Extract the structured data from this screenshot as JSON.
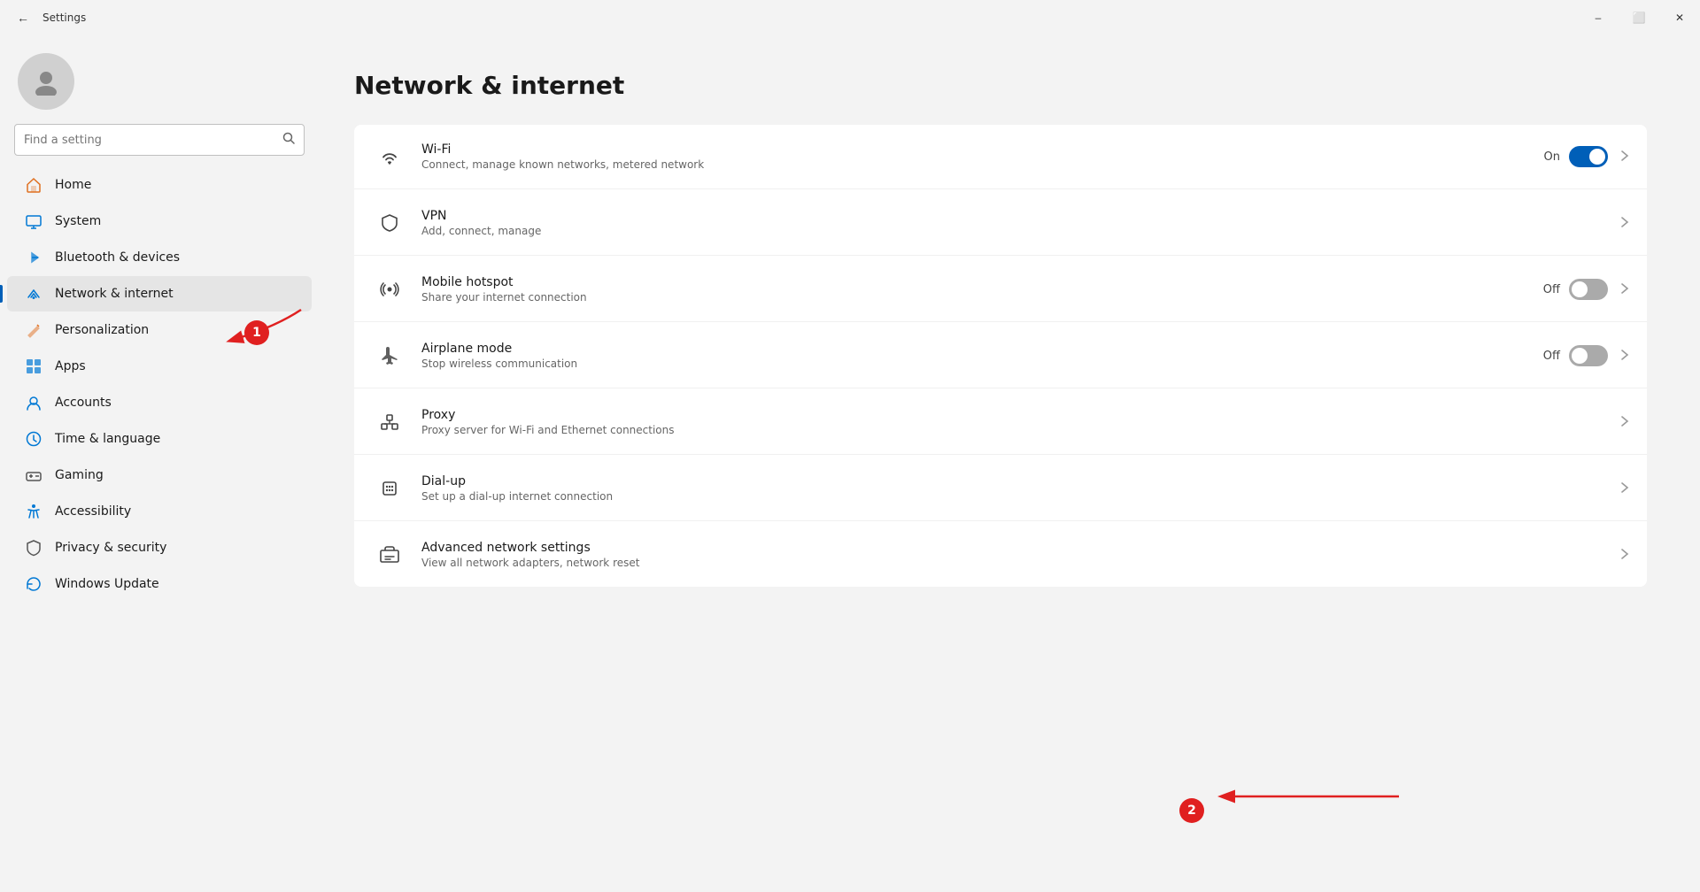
{
  "titlebar": {
    "title": "Settings",
    "back_label": "←",
    "minimize": "–",
    "maximize": "⬜",
    "close": "✕"
  },
  "search": {
    "placeholder": "Find a setting"
  },
  "page": {
    "title": "Network & internet"
  },
  "sidebar": {
    "nav_items": [
      {
        "id": "home",
        "label": "Home",
        "icon": "🏠",
        "color": "#e07020",
        "active": false
      },
      {
        "id": "system",
        "label": "System",
        "icon": "💻",
        "color": "#0078d4",
        "active": false
      },
      {
        "id": "bluetooth",
        "label": "Bluetooth & devices",
        "icon": "🔵",
        "color": "#0078d4",
        "active": false
      },
      {
        "id": "network",
        "label": "Network & internet",
        "icon": "🌐",
        "color": "#0078d4",
        "active": true
      },
      {
        "id": "personalization",
        "label": "Personalization",
        "icon": "✏️",
        "color": "#e07020",
        "active": false
      },
      {
        "id": "apps",
        "label": "Apps",
        "icon": "📦",
        "color": "#0078d4",
        "active": false
      },
      {
        "id": "accounts",
        "label": "Accounts",
        "icon": "👤",
        "color": "#0078d4",
        "active": false
      },
      {
        "id": "time",
        "label": "Time & language",
        "icon": "🌍",
        "color": "#0078d4",
        "active": false
      },
      {
        "id": "gaming",
        "label": "Gaming",
        "icon": "🎮",
        "color": "#666",
        "active": false
      },
      {
        "id": "accessibility",
        "label": "Accessibility",
        "icon": "♿",
        "color": "#005fb8",
        "active": false
      },
      {
        "id": "privacy",
        "label": "Privacy & security",
        "icon": "🛡️",
        "color": "#666",
        "active": false
      },
      {
        "id": "update",
        "label": "Windows Update",
        "icon": "🔄",
        "color": "#0078d4",
        "active": false
      }
    ]
  },
  "settings_items": [
    {
      "id": "wifi",
      "title": "Wi-Fi",
      "desc": "Connect, manage known networks, metered network",
      "icon": "wifi",
      "has_toggle": true,
      "toggle_state": "on",
      "toggle_label": "On",
      "has_chevron": true
    },
    {
      "id": "vpn",
      "title": "VPN",
      "desc": "Add, connect, manage",
      "icon": "vpn",
      "has_toggle": false,
      "has_chevron": true
    },
    {
      "id": "hotspot",
      "title": "Mobile hotspot",
      "desc": "Share your internet connection",
      "icon": "hotspot",
      "has_toggle": true,
      "toggle_state": "off",
      "toggle_label": "Off",
      "has_chevron": true
    },
    {
      "id": "airplane",
      "title": "Airplane mode",
      "desc": "Stop wireless communication",
      "icon": "airplane",
      "has_toggle": true,
      "toggle_state": "off",
      "toggle_label": "Off",
      "has_chevron": true
    },
    {
      "id": "proxy",
      "title": "Proxy",
      "desc": "Proxy server for Wi-Fi and Ethernet connections",
      "icon": "proxy",
      "has_toggle": false,
      "has_chevron": true
    },
    {
      "id": "dialup",
      "title": "Dial-up",
      "desc": "Set up a dial-up internet connection",
      "icon": "dialup",
      "has_toggle": false,
      "has_chevron": true
    },
    {
      "id": "advanced",
      "title": "Advanced network settings",
      "desc": "View all network adapters, network reset",
      "icon": "advanced",
      "has_toggle": false,
      "has_chevron": true
    }
  ],
  "annotations": [
    {
      "id": "1",
      "label": "1"
    },
    {
      "id": "2",
      "label": "2"
    }
  ]
}
